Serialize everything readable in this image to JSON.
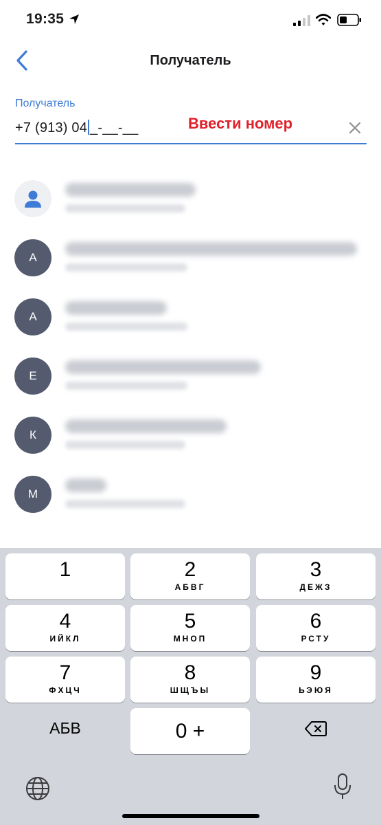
{
  "status_bar": {
    "time": "19:35"
  },
  "header": {
    "title": "Получатель"
  },
  "recipient_field": {
    "label": "Получатель",
    "value_typed": "+7 (913) 04",
    "value_mask": "_-__-__",
    "annotation": "Ввести номер"
  },
  "contacts": [
    {
      "avatar_letter": "",
      "type": "self",
      "icon": "person-icon"
    },
    {
      "avatar_letter": "А"
    },
    {
      "avatar_letter": "А"
    },
    {
      "avatar_letter": "Е"
    },
    {
      "avatar_letter": "К"
    },
    {
      "avatar_letter": "М"
    }
  ],
  "keyboard": {
    "keys": [
      {
        "digit": "1",
        "letters": ""
      },
      {
        "digit": "2",
        "letters": "АБВГ"
      },
      {
        "digit": "3",
        "letters": "ДЕЖЗ"
      },
      {
        "digit": "4",
        "letters": "ИЙКЛ"
      },
      {
        "digit": "5",
        "letters": "МНОП"
      },
      {
        "digit": "6",
        "letters": "РСТУ"
      },
      {
        "digit": "7",
        "letters": "ФХЦЧ"
      },
      {
        "digit": "8",
        "letters": "ШЩЪЫ"
      },
      {
        "digit": "9",
        "letters": "ЬЭЮЯ"
      }
    ],
    "abc_label": "АБВ",
    "zero_label": "0 +",
    "delete_icon": "backspace-icon",
    "globe_icon": "globe-icon",
    "mic_icon": "microphone-icon"
  },
  "colors": {
    "accent": "#3d7bd6",
    "annotation": "#e0202a",
    "avatar": "#545b6e",
    "keyboard_bg": "#d3d5dc"
  }
}
